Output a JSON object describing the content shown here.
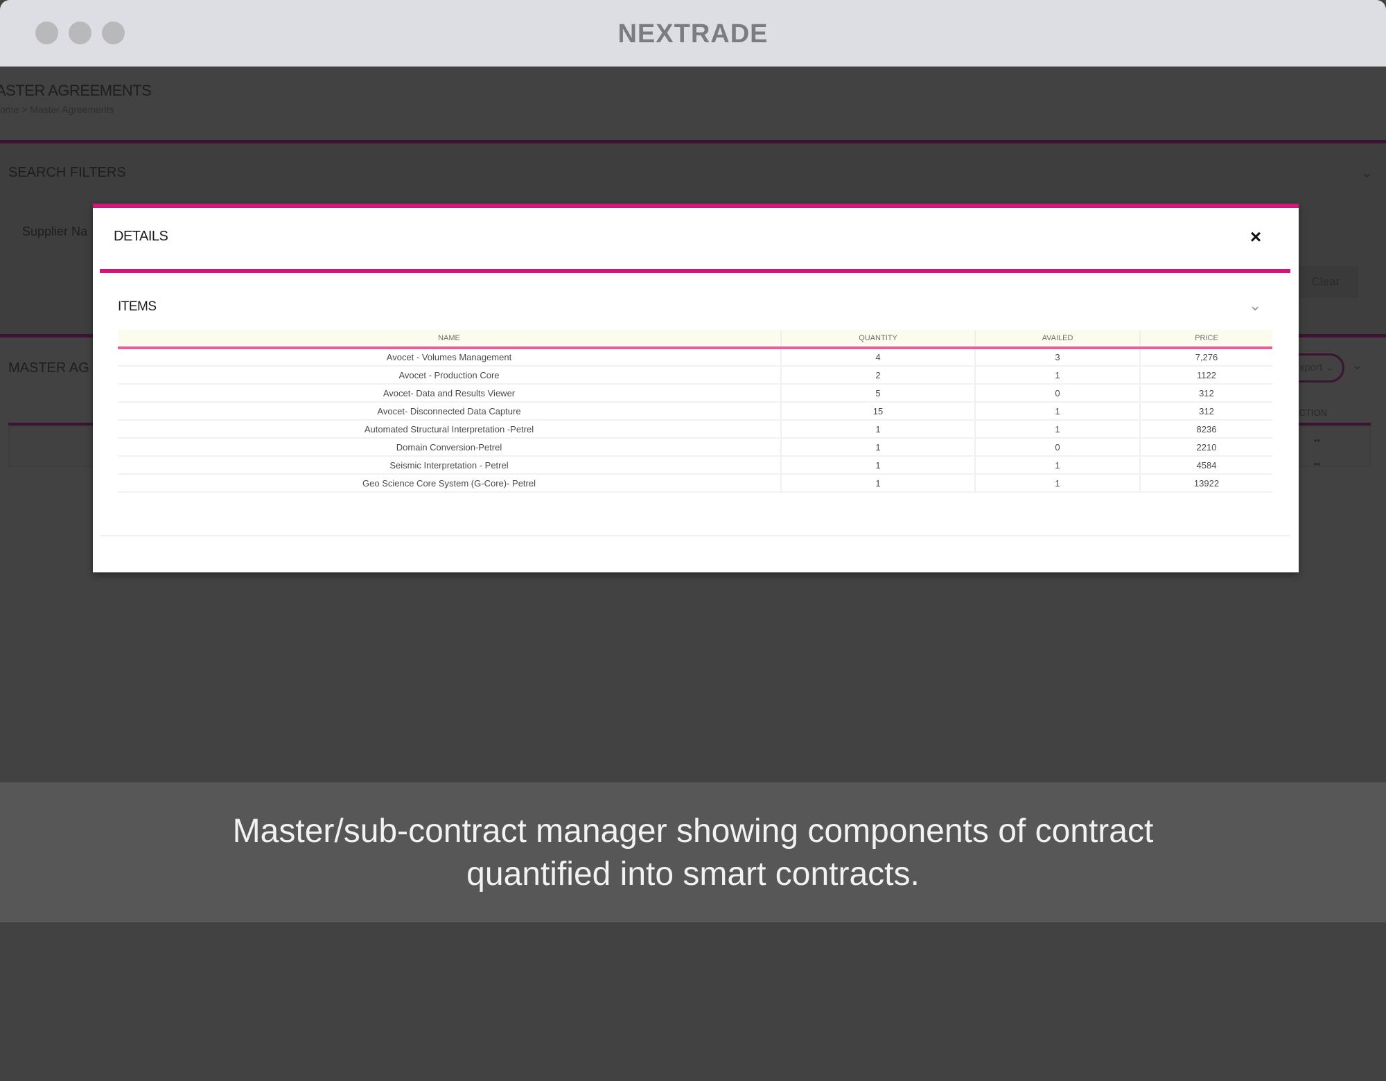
{
  "window": {
    "title": "NEXTRADE"
  },
  "background": {
    "header_title": "ASTER AGREEMENTS",
    "breadcrumb": "ome  >  Master Agreements",
    "search_filters_title": "SEARCH FILTERS",
    "supplier_label": "Supplier Na",
    "clear_button": "Clear",
    "master_section_title": "MASTER AG",
    "export_pill": "Export ⌄",
    "action_header": "ACTION"
  },
  "modal": {
    "title": "DETAILS",
    "close_label": "×",
    "items_title": "ITEMS",
    "table": {
      "headers": [
        "NAME",
        "QUANTITY",
        "AVAILED",
        "PRICE"
      ],
      "rows": [
        [
          "Avocet - Volumes Management",
          "4",
          "3",
          "7,276"
        ],
        [
          "Avocet - Production Core",
          "2",
          "1",
          "1122"
        ],
        [
          "Avocet- Data and Results Viewer",
          "5",
          "0",
          "312"
        ],
        [
          "Avocet- Disconnected Data Capture",
          "15",
          "1",
          "312"
        ],
        [
          "Automated Structural Interpretation -Petrel",
          "1",
          "1",
          "8236"
        ],
        [
          "Domain Conversion-Petrel",
          "1",
          "0",
          "2210"
        ],
        [
          "Seismic Interpretation - Petrel",
          "1",
          "1",
          "4584"
        ],
        [
          "Geo Science Core System (G-Core)- Petrel",
          "1",
          "1",
          "13922"
        ]
      ]
    }
  },
  "caption": {
    "line1": "Master/sub-contract manager showing components of contract",
    "line2": "quantified into smart contracts."
  }
}
